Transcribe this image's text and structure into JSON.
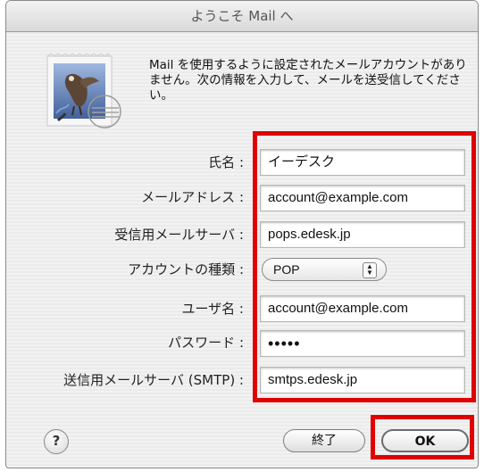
{
  "window": {
    "title": "ようこそ Mail へ"
  },
  "intro": {
    "text": "Mail を使用するように設定されたメールアカウントがありません。次の情報を入力して、メールを送受信してください。"
  },
  "form": {
    "name": {
      "label": "氏名 :",
      "value": "イーデスク"
    },
    "email": {
      "label": "メールアドレス :",
      "value": "account@example.com"
    },
    "incoming_server": {
      "label": "受信用メールサーバ :",
      "value": "pops.edesk.jp"
    },
    "account_type": {
      "label": "アカウントの種類 :",
      "value": "POP"
    },
    "username": {
      "label": "ユーザ名 :",
      "value": "account@example.com"
    },
    "password": {
      "label": "パスワード :",
      "value": "•••••"
    },
    "outgoing_server": {
      "label": "送信用メールサーバ (SMTP) :",
      "value": "smtps.edesk.jp"
    }
  },
  "buttons": {
    "help": "?",
    "quit": "終了",
    "ok": "OK"
  },
  "icons": {
    "app": "mail-stamp-eagle-icon",
    "select_arrows": "up-down-arrows-icon"
  },
  "highlight": {
    "color": "#e00000"
  }
}
